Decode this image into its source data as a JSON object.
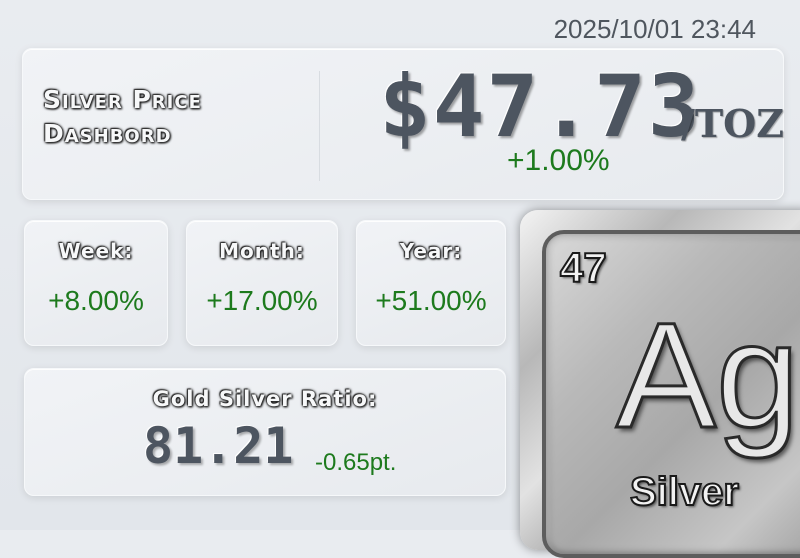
{
  "timestamp": "2025/10/01 23:44",
  "header": {
    "title_line1": "Silver Price",
    "title_line2": "Dashbord",
    "price": "$47.73",
    "unit": "/TOZ",
    "change": "+1.00%"
  },
  "periods": {
    "week": {
      "label": "Week:",
      "value": "+8.00%"
    },
    "month": {
      "label": "Month:",
      "value": "+17.00%"
    },
    "year": {
      "label": "Year:",
      "value": "+51.00%"
    }
  },
  "ratio": {
    "label": "Gold Silver Ratio:",
    "value": "81.21",
    "change": "-0.65pt."
  },
  "element_tile": {
    "number": "47",
    "symbol": "Ag",
    "name": "Silver"
  },
  "colors": {
    "positive": "#1d7a1d",
    "metal_text": "#4d5560",
    "background": "#e6e9ed"
  }
}
